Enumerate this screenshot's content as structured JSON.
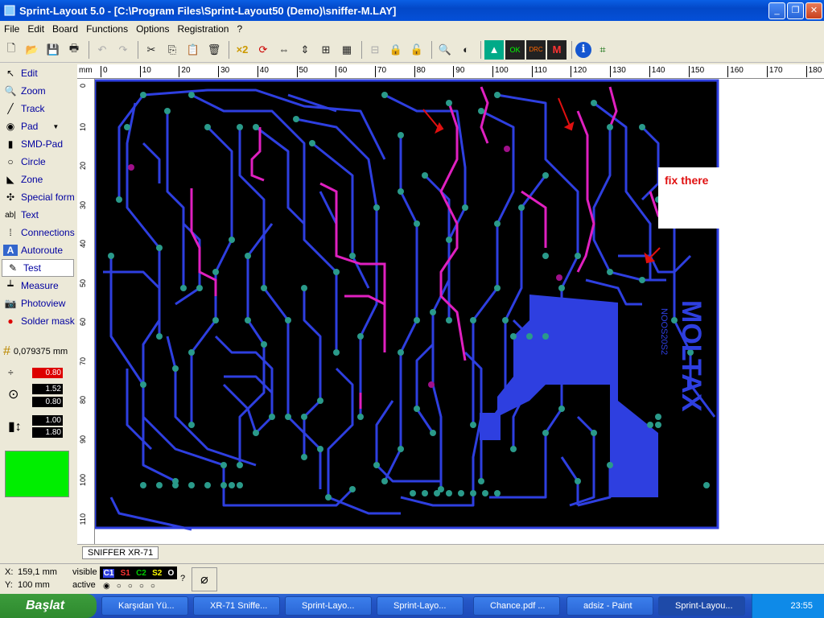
{
  "window": {
    "title": "Sprint-Layout 5.0 - [C:\\Program Files\\Sprint-Layout50 (Demo)\\sniffer-M.LAY]"
  },
  "menu": [
    "File",
    "Edit",
    "Board",
    "Functions",
    "Options",
    "Registration",
    "?"
  ],
  "tools": [
    {
      "label": "Edit",
      "icon": "arrow-icon"
    },
    {
      "label": "Zoom",
      "icon": "magnifier-icon"
    },
    {
      "label": "Track",
      "icon": "track-icon"
    },
    {
      "label": "Pad",
      "icon": "pad-icon"
    },
    {
      "label": "SMD-Pad",
      "icon": "smd-pad-icon"
    },
    {
      "label": "Circle",
      "icon": "circle-icon"
    },
    {
      "label": "Zone",
      "icon": "zone-icon"
    },
    {
      "label": "Special form",
      "icon": "special-form-icon"
    },
    {
      "label": "Text",
      "icon": "text-icon"
    },
    {
      "label": "Connections",
      "icon": "connections-icon"
    },
    {
      "label": "Autoroute",
      "icon": "autoroute-icon"
    },
    {
      "label": "Test",
      "icon": "test-icon"
    },
    {
      "label": "Measure",
      "icon": "measure-icon"
    },
    {
      "label": "Photoview",
      "icon": "photoview-icon"
    },
    {
      "label": "Solder mask",
      "icon": "solder-mask-icon"
    }
  ],
  "grid": {
    "value": "0,079375 mm"
  },
  "params": {
    "track_width": "0.80",
    "pad_outer": "1.52",
    "pad_inner": "0.80",
    "smd_w": "1.00",
    "smd_h": "1.80"
  },
  "ruler": {
    "unit": "mm",
    "top": [
      "0",
      "10",
      "20",
      "30",
      "40",
      "50",
      "60",
      "70",
      "80",
      "90",
      "100",
      "110",
      "120",
      "130",
      "140",
      "150",
      "160",
      "170",
      "180"
    ],
    "left": [
      "0",
      "10",
      "20",
      "30",
      "40",
      "50",
      "60",
      "70",
      "80",
      "90",
      "100",
      "110"
    ]
  },
  "annotation": {
    "text": "fix there"
  },
  "silkscreen": {
    "main": "MOLTAX",
    "sub": "NOOS20S2"
  },
  "tab": {
    "label": "SNIFFER XR-71"
  },
  "status": {
    "x_label": "X:",
    "x_value": "159,1 mm",
    "y_label": "Y:",
    "y_value": "100 mm",
    "visible_label": "visible",
    "active_label": "active",
    "layers": [
      "C1",
      "S1",
      "C2",
      "S2",
      "O"
    ],
    "help": "?"
  },
  "taskbar": {
    "start": "Başlat",
    "tasks": [
      "Karşıdan Yü...",
      "XR-71 Sniffe...",
      "Sprint-Layo...",
      "Sprint-Layo...",
      "Chance.pdf ...",
      "adsiz - Paint",
      "Sprint-Layou..."
    ],
    "clock": "23:55"
  },
  "colors": {
    "board": "#000000",
    "copper": "#2E3FE0",
    "copper2": "#E020C0",
    "pad": "#2A9A8A",
    "annotation": "#E01010"
  }
}
